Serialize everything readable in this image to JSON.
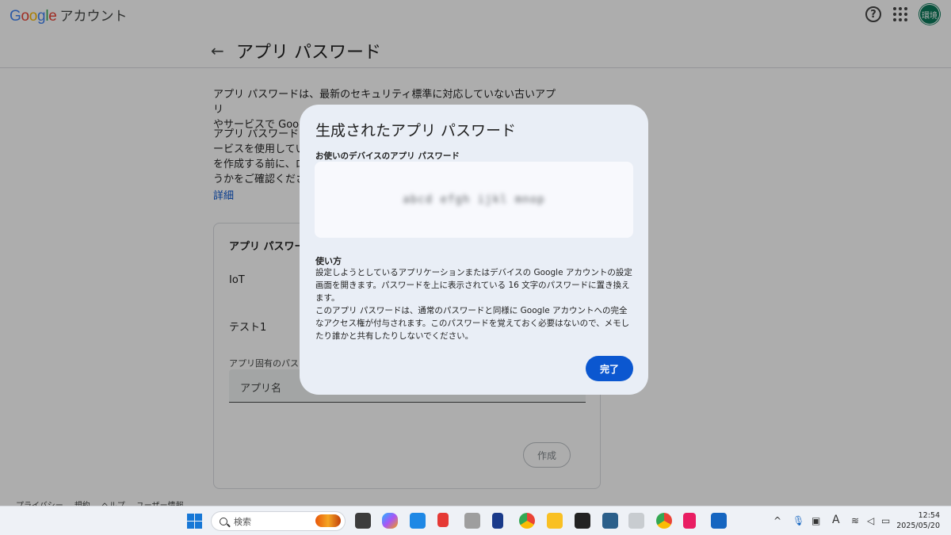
{
  "header": {
    "logo": "Google",
    "product": "アカウント",
    "avatar_text": "環境"
  },
  "page": {
    "title": "アプリ パスワード",
    "desc1_line1": "アプリ パスワードは、最新のセキュリティ標準に対応していない古いアプリ",
    "desc1_line2": "やサービスで Google",
    "desc2_line1": "アプリ パスワードに",
    "desc2_line2": "ービスを使用してい",
    "desc2_line3": "を作成する前に、ロ",
    "desc2_line4": "うかをご確認くださ",
    "learn_more": "詳細"
  },
  "card": {
    "title": "アプリ パスワー",
    "items": [
      "IoT",
      "テスト1"
    ],
    "input_label": "アプリ固有のパス",
    "input_placeholder": "アプリ名",
    "create_label": "作成"
  },
  "footer": {
    "links": [
      "プライバシー",
      "規約",
      "ヘルプ",
      "ユーザー情報"
    ]
  },
  "dialog": {
    "title": "生成されたアプリ パスワード",
    "subtitle": "お使いのデバイスのアプリ パスワード",
    "password": "abcd efgh ijkl mnop",
    "howto_title": "使い方",
    "howto_p1": "設定しようとしているアプリケーションまたはデバイスの Google アカウントの設定画面を開きます。パスワードを上に表示されている 16 文字のパスワードに置き換えます。",
    "howto_p2": "このアプリ パスワードは、通常のパスワードと同様に Google アカウントへの完全なアクセス権が付与されます。このパスワードを覚えておく必要はないので、メモしたり誰かと共有したりしないでください。",
    "done_label": "完了"
  },
  "taskbar": {
    "search_placeholder": "検索",
    "time": "12:54",
    "date": "2025/05/20",
    "ime": "A"
  },
  "colors": {
    "accent": "#0b57d0",
    "dialog_bg": "#e9eef6",
    "avatar": "#0b7a5a"
  }
}
